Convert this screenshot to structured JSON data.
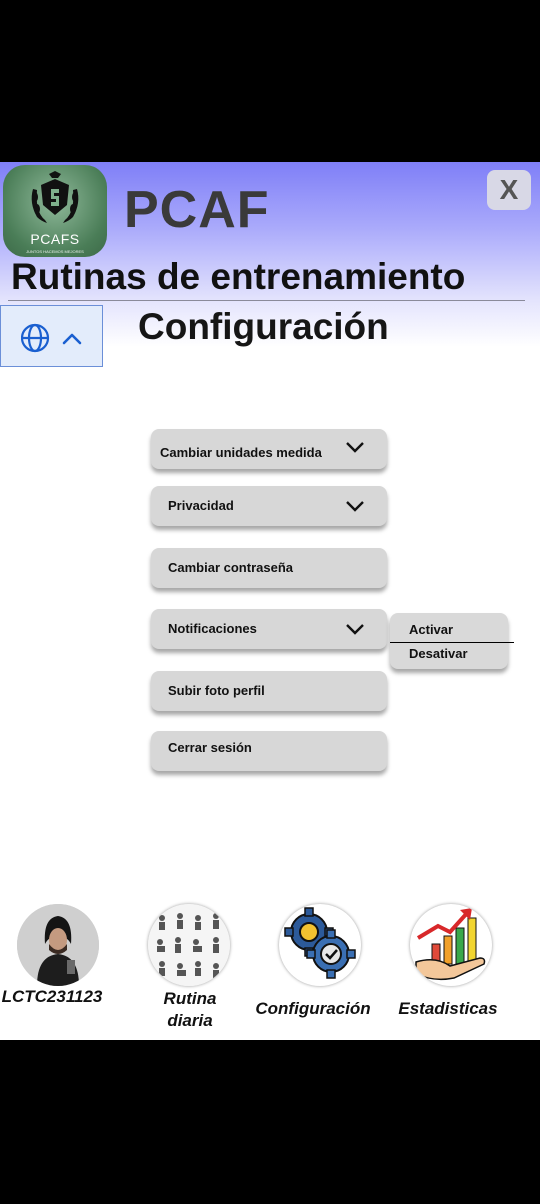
{
  "header": {
    "logo_text": "PCAFS",
    "logo_subtext": "JUNTOS HACEMOS MEJORES",
    "brand": "PCAF",
    "close_label": "X",
    "title": "Rutinas de entrenamiento",
    "subtitle": "Configuración"
  },
  "menu": {
    "items": [
      {
        "label": "Cambiar unidades  medida",
        "has_dropdown": true
      },
      {
        "label": "Privacidad",
        "has_dropdown": true
      },
      {
        "label": "Cambiar contraseña",
        "has_dropdown": false
      },
      {
        "label": "Notificaciones",
        "has_dropdown": true
      },
      {
        "label": "Subir foto perfil",
        "has_dropdown": false
      },
      {
        "label": "Cerrar sesión",
        "has_dropdown": false
      }
    ]
  },
  "notifications_popup": {
    "options": [
      "Activar",
      "Desativar"
    ]
  },
  "bottom_nav": {
    "items": [
      {
        "label": "LCTC231123",
        "icon": "user-avatar"
      },
      {
        "label_line1": "Rutina",
        "label_line2": "diaria",
        "icon": "exercise-grid-icon"
      },
      {
        "label": "Configuración",
        "icon": "gears-icon"
      },
      {
        "label": "Estadisticas",
        "icon": "growth-chart-icon"
      }
    ]
  },
  "colors": {
    "header_gradient_top": "#7f7ff7",
    "accent_blue": "#1a5fd0",
    "menu_bg": "#d7d7d7"
  }
}
